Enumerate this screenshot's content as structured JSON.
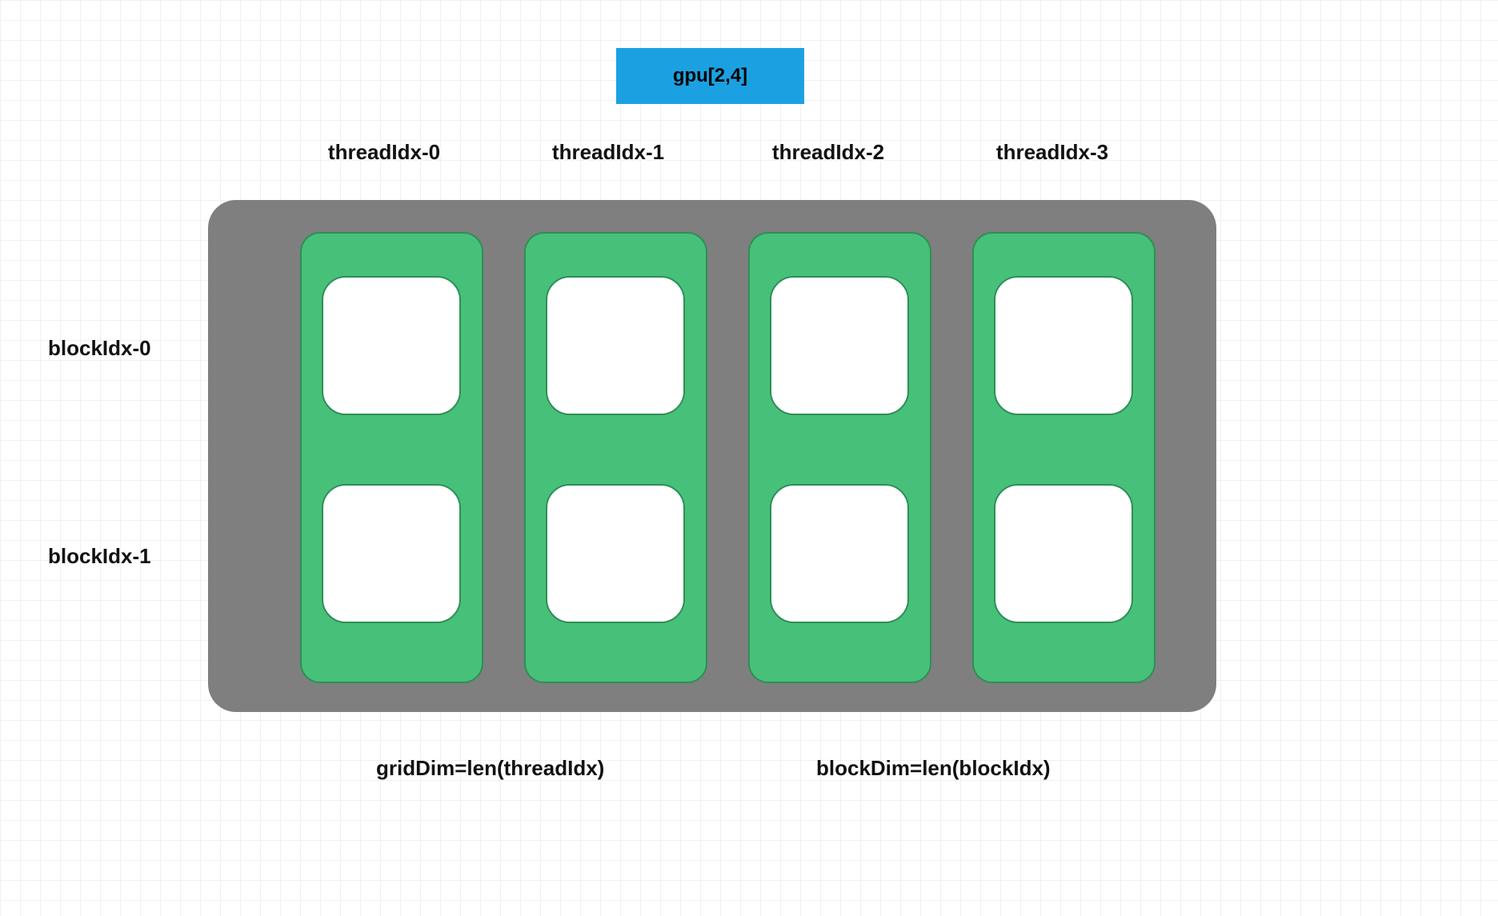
{
  "title_badge": "gpu[2,4]",
  "thread_headers": [
    "threadIdx-0",
    "threadIdx-1",
    "threadIdx-2",
    "threadIdx-3"
  ],
  "block_labels": [
    "blockIdx-0",
    "blockIdx-1"
  ],
  "bottom_labels": {
    "left": "gridDim=len(threadIdx)",
    "right": "blockDim=len(blockIdx)"
  },
  "colors": {
    "badge_bg": "#1ba1e2",
    "container_bg": "#7f7f7f",
    "column_bg": "#47c07a",
    "column_border": "#2e8f56",
    "cell_bg": "#ffffff"
  },
  "grid_shape": {
    "blocks": 2,
    "threads": 4
  },
  "chart_data": {
    "type": "table",
    "description": "Illustration of a CUDA-style GPU execution grid gpu[2,4]: 2 blockIdx rows × 4 threadIdx columns. Four green thread-columns, each containing two white blocks, inside a grey rounded container.",
    "rows": [
      "blockIdx-0",
      "blockIdx-1"
    ],
    "cols": [
      "threadIdx-0",
      "threadIdx-1",
      "threadIdx-2",
      "threadIdx-3"
    ],
    "annotations": {
      "gridDim": "len(threadIdx)",
      "blockDim": "len(blockIdx)"
    }
  }
}
